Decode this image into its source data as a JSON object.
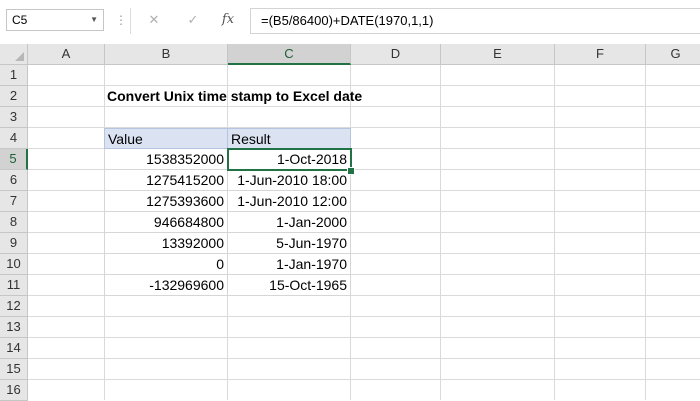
{
  "formula_bar": {
    "name_box": "C5",
    "cancel_icon": "✕",
    "enter_icon": "✓",
    "fx_label": "fx",
    "formula": "=(B5/86400)+DATE(1970,1,1)"
  },
  "columns": [
    "A",
    "B",
    "C",
    "D",
    "E",
    "F",
    "G"
  ],
  "rows": [
    "1",
    "2",
    "3",
    "4",
    "5",
    "6",
    "7",
    "8",
    "9",
    "10",
    "11",
    "12",
    "13",
    "14",
    "15",
    "16"
  ],
  "active_cell": {
    "column": "C",
    "row": "5"
  },
  "sheet": {
    "title": "Convert Unix time stamp to Excel date",
    "table": {
      "headers": [
        "Value",
        "Result"
      ],
      "rows": [
        [
          "1538352000",
          "1-Oct-2018"
        ],
        [
          "1275415200",
          "1-Jun-2010 18:00"
        ],
        [
          "1275393600",
          "1-Jun-2010 12:00"
        ],
        [
          "946684800",
          "1-Jan-2000"
        ],
        [
          "13392000",
          "5-Jun-1970"
        ],
        [
          "0",
          "1-Jan-1970"
        ],
        [
          "-132969600",
          "15-Oct-1965"
        ]
      ]
    }
  },
  "colors": {
    "accent": "#217346",
    "table_header": "#dbe3f3"
  }
}
